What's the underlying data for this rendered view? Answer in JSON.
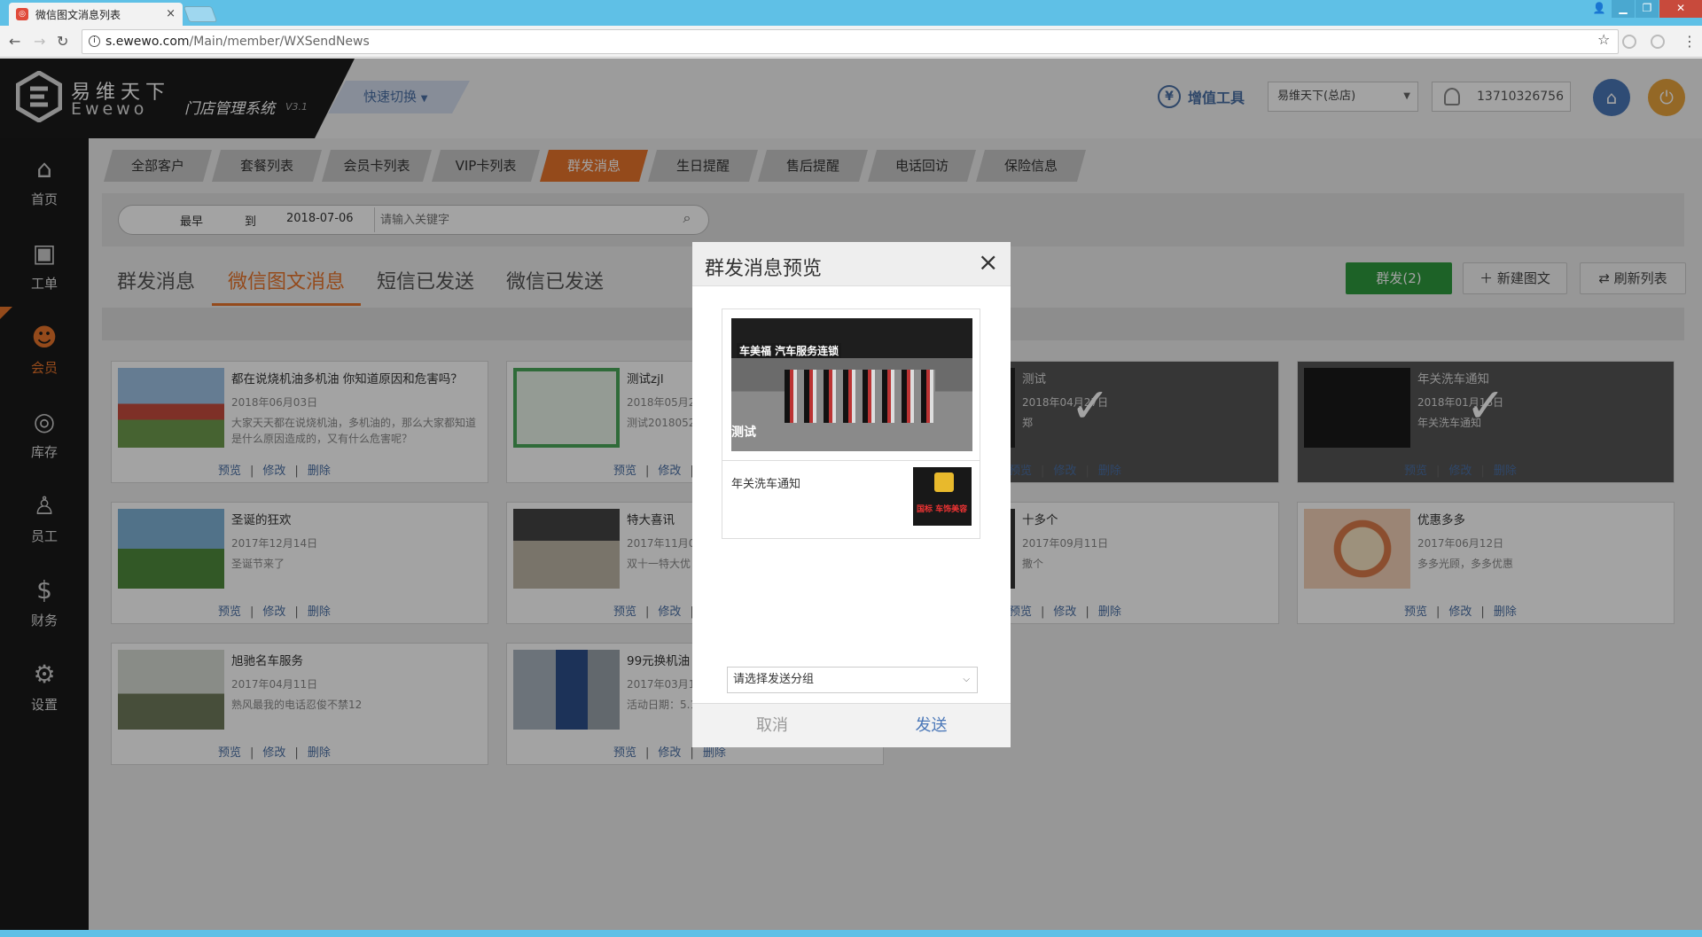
{
  "browser": {
    "tab_title": "微信图文消息列表",
    "tab_close": "×",
    "url_host": "s.ewewo.com",
    "url_path": "/Main/member/WXSendNews"
  },
  "header": {
    "brand_cn": "易维天下",
    "brand_en": "Ewewo",
    "system_name": "门店管理系统",
    "system_version": "V3.1",
    "quick_switch": "快速切换",
    "value_tools": "增值工具",
    "store": "易维天下(总店)",
    "phone": "13710326756"
  },
  "sidebar": {
    "items": [
      {
        "label": "首页",
        "icon": "home-icon"
      },
      {
        "label": "工单",
        "icon": "id-card-icon"
      },
      {
        "label": "会员",
        "icon": "members-icon"
      },
      {
        "label": "库存",
        "icon": "inventory-icon"
      },
      {
        "label": "员工",
        "icon": "staff-icon"
      },
      {
        "label": "财务",
        "icon": "finance-icon"
      },
      {
        "label": "设置",
        "icon": "gear-icon"
      }
    ],
    "active": "会员"
  },
  "subtabs": [
    "全部客户",
    "套餐列表",
    "会员卡列表",
    "VIP卡列表",
    "群发消息",
    "生日提醒",
    "售后提醒",
    "电话回访",
    "保险信息"
  ],
  "subtab_active": "群发消息",
  "search": {
    "from": "最早",
    "to_label": "到",
    "to": "2018-07-06",
    "placeholder": "请输入关键字"
  },
  "content_tabs": [
    "群发消息",
    "微信图文消息",
    "短信已发送",
    "微信已发送"
  ],
  "content_tab_active": "微信图文消息",
  "actions": {
    "mass_send": "群发(2)",
    "new_article": "新建图文",
    "refresh": "刷新列表"
  },
  "card_actions": {
    "preview": "预览",
    "edit": "修改",
    "delete": "删除",
    "sep": "|"
  },
  "cards": [
    {
      "title": "都在说烧机油多机油 你知道原因和危害吗？",
      "date": "2018年06月03日",
      "desc": "大家天天都在说烧机油，多机油的，那么大家都知道是什么原因造成的，又有什么危害呢？",
      "selected": false
    },
    {
      "title": "测试zjl",
      "date": "2018年05月2",
      "desc": "测试2018052",
      "selected": false
    },
    {
      "title": "测试",
      "date": "2018年04月27日",
      "desc": "郑",
      "selected": true
    },
    {
      "title": "年关洗车通知",
      "date": "2018年01月18日",
      "desc": "年关洗车通知",
      "selected": true
    },
    {
      "title": "圣诞的狂欢",
      "date": "2017年12月14日",
      "desc": "圣诞节来了",
      "selected": false
    },
    {
      "title": "特大喜讯",
      "date": "2017年11月0",
      "desc": "双十一特大优",
      "selected": false
    },
    {
      "title": "十多个",
      "date": "2017年09月11日",
      "desc": "撒个",
      "selected": false
    },
    {
      "title": "优惠多多",
      "date": "2017年06月12日",
      "desc": "多多光顾，多多优惠",
      "selected": false
    },
    {
      "title": "旭驰名车服务",
      "date": "2017年04月11日",
      "desc": "熟风最我的电话忍俊不禁12",
      "selected": false
    },
    {
      "title": "99元换机油",
      "date": "2017年03月1",
      "desc": "活动日期：5.1",
      "selected": false
    }
  ],
  "modal": {
    "title": "群发消息预览",
    "close": "×",
    "cover_title": "测试",
    "cover_sign": "车美福 汽车服务连锁",
    "item_title": "年关洗车通知",
    "item_sign": "国标 车饰美容",
    "group_select": "请选择发送分组",
    "cancel": "取消",
    "send": "发送"
  },
  "colors": {
    "accent": "#e8742b",
    "brand_blue": "#4a77b8",
    "send_green": "#2e9a3e",
    "sidebar_bg": "#1a1a1a"
  }
}
